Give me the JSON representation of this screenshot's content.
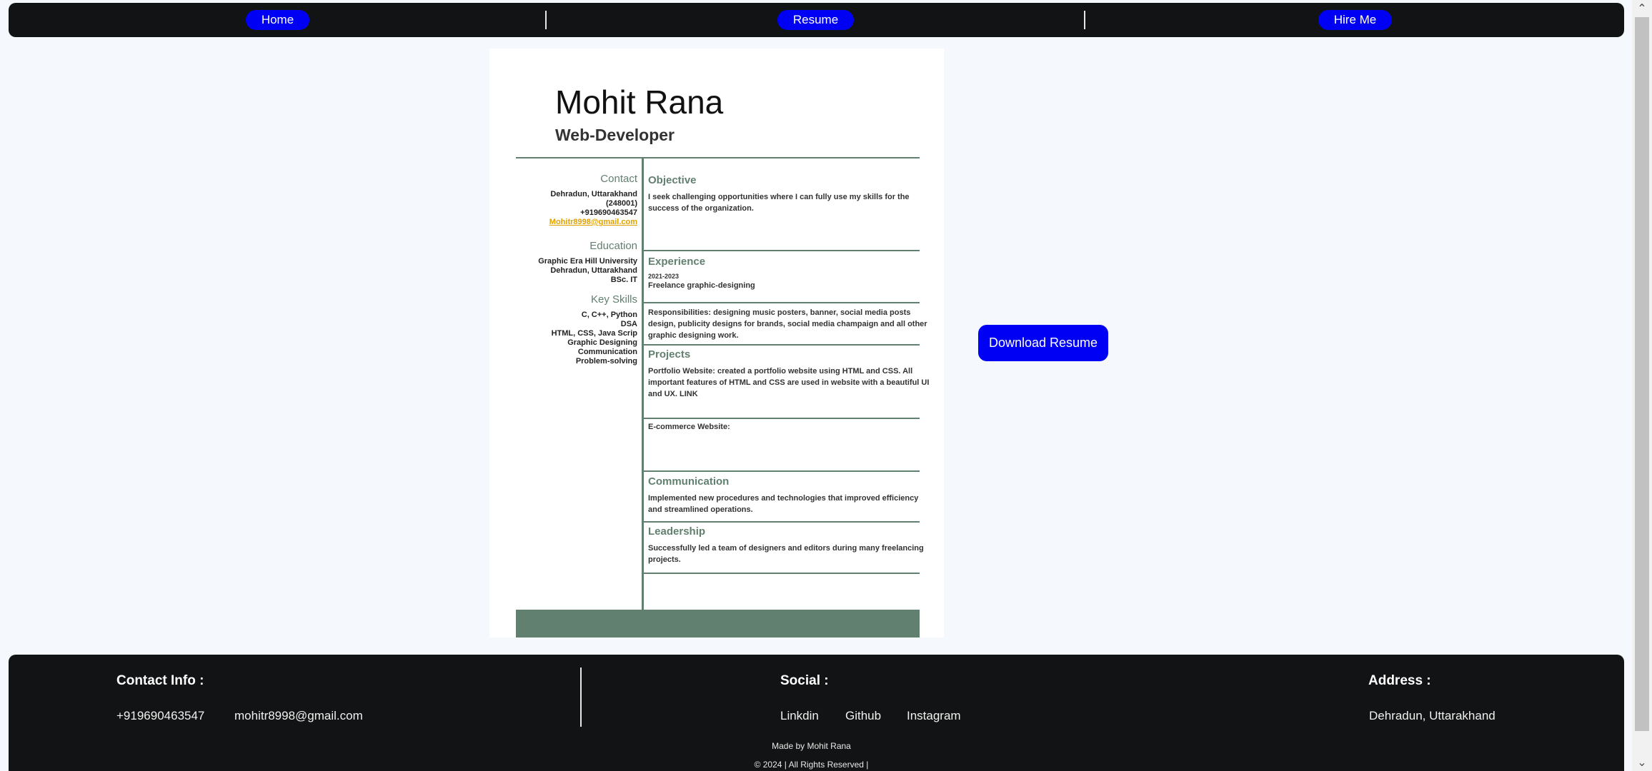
{
  "nav": {
    "items": [
      "Home",
      "Resume",
      "Hire Me"
    ]
  },
  "resume": {
    "name": "Mohit Rana",
    "role": "Web-Developer",
    "contact": {
      "heading": "Contact",
      "address_line1": "Dehradun, Uttarakhand",
      "address_line2": "(248001)",
      "phone": "+919690463547",
      "email": "Mohitr8998@gmail.com"
    },
    "education": {
      "heading": "Education",
      "lines": [
        "Graphic Era Hill University",
        "Dehradun, Uttarakhand",
        "BSc. IT"
      ]
    },
    "skills": {
      "heading": "Key Skills",
      "lines": [
        "C, C++, Python",
        "DSA",
        "HTML, CSS, Java Scrip",
        "Graphic Designing",
        "Communication",
        "Problem-solving"
      ]
    },
    "objective": {
      "heading": "Objective",
      "text": "I seek challenging opportunities where I can fully use my skills for the success of the organization."
    },
    "experience": {
      "heading": "Experience",
      "date": "2021-2023",
      "title": "Freelance graphic-designing",
      "responsibilities": "Responsibilities: designing music posters, banner, social media posts design, publicity designs for brands, social media champaign and all other graphic designing work."
    },
    "projects": {
      "heading": "Projects",
      "portfolio": "Portfolio Website: created a portfolio website using HTML and CSS. All important features of HTML and CSS are used in website with a beautiful UI and UX. LINK",
      "ecommerce": "E-commerce Website:"
    },
    "communication": {
      "heading": "Communication",
      "text": "Implemented new procedures and technologies that improved efficiency and streamlined operations."
    },
    "leadership": {
      "heading": "Leadership",
      "text": "Successfully led a team of designers and editors during many freelancing projects."
    }
  },
  "download_button": "Download Resume",
  "footer": {
    "contact_heading": "Contact Info :",
    "phone": "+919690463547",
    "email": "mohitr8998@gmail.com",
    "social_heading": "Social :",
    "social_links": [
      "Linkdin",
      "Github",
      "Instagram"
    ],
    "address_heading": "Address :",
    "address": "Dehradun, Uttarakhand",
    "made_by": "Made by Mohit Rana",
    "copyright": "© 2024 | All Rights Reserved |"
  }
}
